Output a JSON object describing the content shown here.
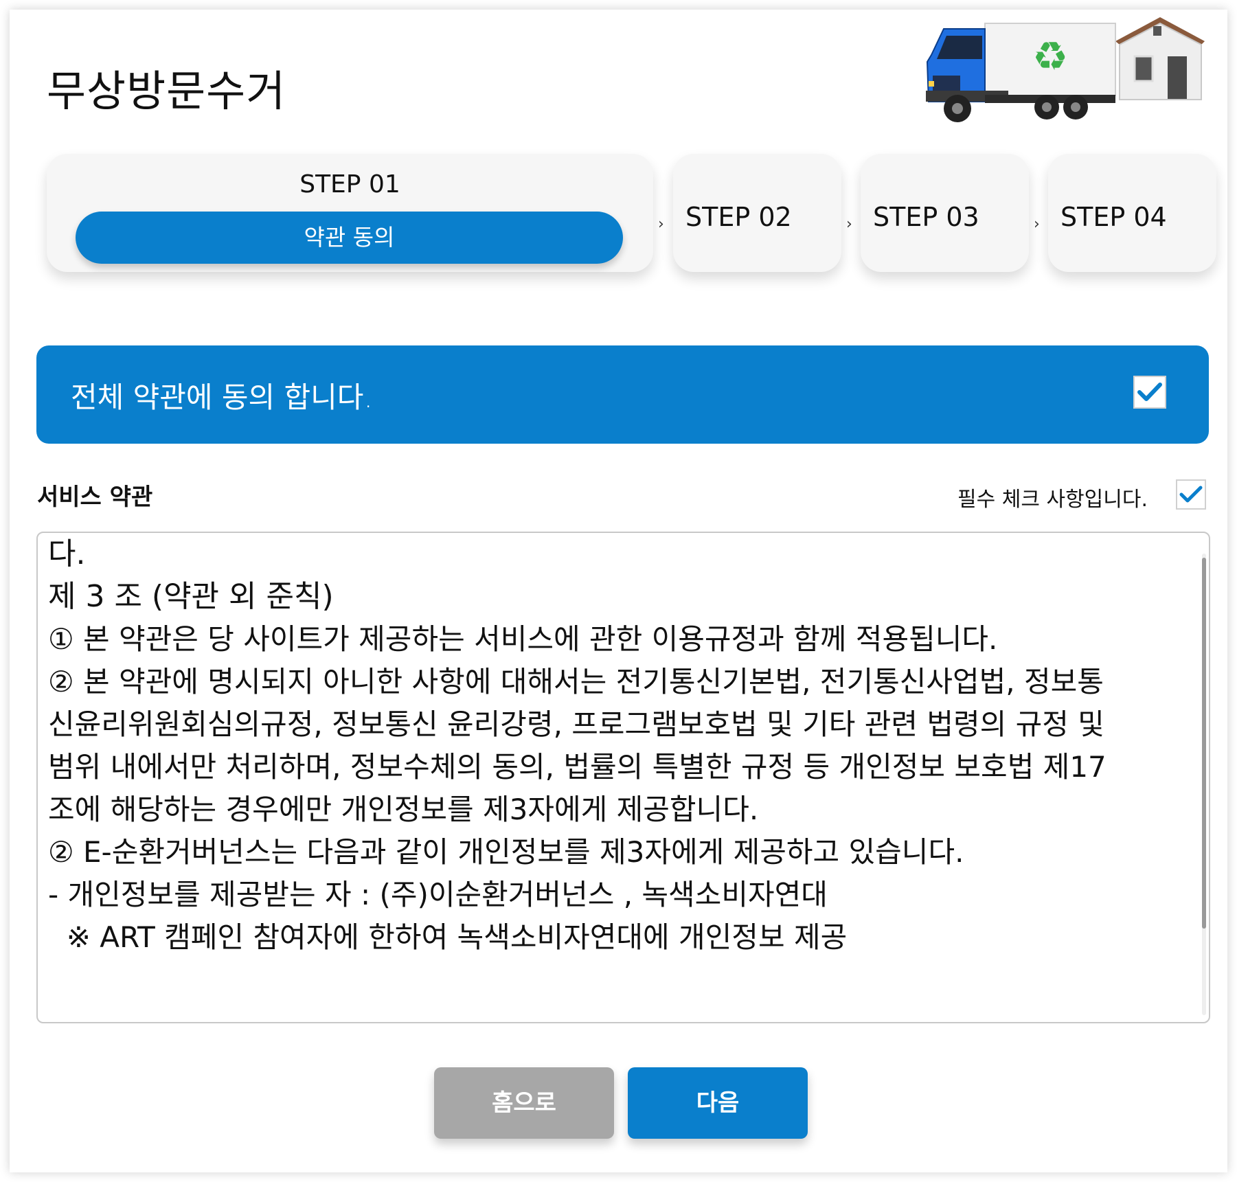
{
  "header": {
    "title": "무상방문수거"
  },
  "steps": [
    {
      "title": "STEP 01",
      "label": "약관 동의",
      "active": true
    },
    {
      "title": "STEP 02",
      "active": false
    },
    {
      "title": "STEP 03",
      "active": false
    },
    {
      "title": "STEP 04",
      "active": false
    }
  ],
  "agree_all": {
    "label": "전체 약관에 동의 합니다.",
    "checked": true
  },
  "service_terms": {
    "title": "서비스 약관",
    "required_label": "필수 체크 사항입니다.",
    "checked": true,
    "lines": [
      "다.",
      "제 3 조 (약관 외 준칙)",
      "① 본 약관은 당 사이트가 제공하는 서비스에 관한 이용규정과 함께 적용됩니다.",
      "② 본 약관에 명시되지 아니한 사항에 대해서는 전기통신기본법, 전기통신사업법, 정보통",
      "신윤리위원회심의규정, 정보통신 윤리강령, 프로그램보호법 및 기타 관련 법령의 규정 및",
      "범위 내에서만 처리하며, 정보수체의 동의, 법률의 특별한 규정 등 개인정보 보호법 제17",
      "조에 해당하는 경우에만 개인정보를 제3자에게 제공합니다.",
      "",
      "② E-순환거버넌스는 다음과 같이 개인정보를 제3자에게 제공하고 있습니다.",
      "- 개인정보를 제공받는 자 : (주)이순환거버넌스 , 녹색소비자연대",
      "  ※ ART 캠페인 참여자에 한하여 녹색소비자연대에 개인정보 제공"
    ]
  },
  "buttons": {
    "home": "홈으로",
    "next": "다음"
  },
  "colors": {
    "primary": "#0a7fcc",
    "secondary": "#a7a7a7",
    "step_bg": "#f6f6f6"
  },
  "icons": {
    "chevron": "chevron-right-icon",
    "check": "check-icon",
    "hero": "truck-house-illustration"
  }
}
